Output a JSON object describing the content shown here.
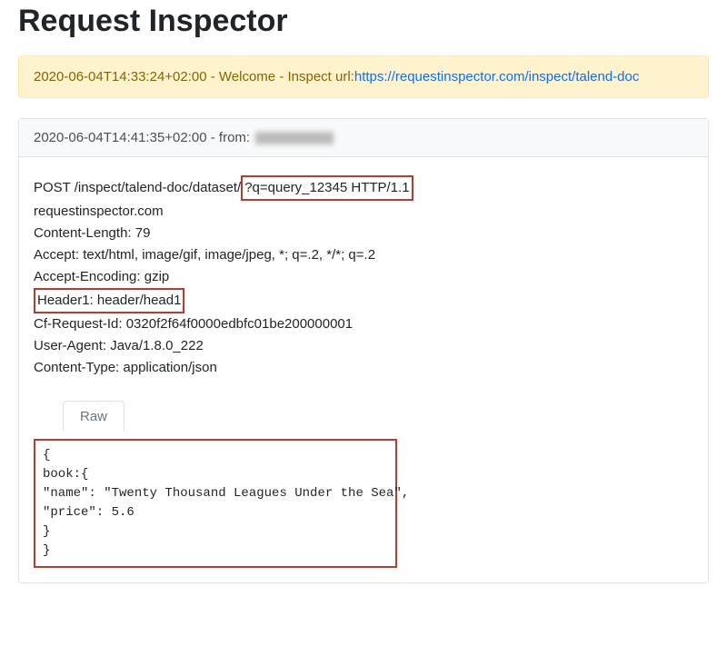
{
  "page": {
    "title": "Request Inspector"
  },
  "welcome": {
    "timestamp": "2020-06-04T14:33:24+02:00",
    "message": " - Welcome - Inspect url:",
    "url": "https://requestinspector.com/inspect/talend-doc"
  },
  "request": {
    "header": {
      "timestamp": "2020-06-04T14:41:35+02:00",
      "from_label": " - from: "
    },
    "line1_method_path": "POST /inspect/talend-doc/dataset/",
    "line1_highlighted": "?q=query_12345 HTTP/1.1",
    "host": "requestinspector.com",
    "content_length": "Content-Length: 79",
    "accept": "Accept: text/html, image/gif, image/jpeg, *; q=.2, */*; q=.2",
    "accept_encoding": "Accept-Encoding: gzip",
    "header1": "Header1: header/head1",
    "cf_request_id": "Cf-Request-Id: 0320f2f64f0000edbfc01be200000001",
    "user_agent": "User-Agent: Java/1.8.0_222",
    "content_type": "Content-Type: application/json"
  },
  "tabs": {
    "raw": "Raw"
  },
  "body": {
    "l1": "{",
    "l2": "book:{",
    "l3": "\"name\": \"Twenty Thousand Leagues Under the Sea\",",
    "l4": "\"price\": 5.6",
    "l5": "}",
    "l6": "}"
  }
}
